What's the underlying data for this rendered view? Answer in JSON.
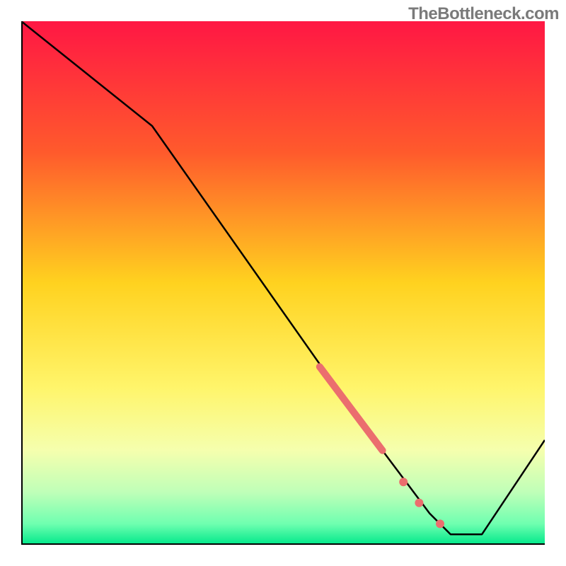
{
  "watermark": "TheBottleneck.com",
  "chart_data": {
    "type": "line",
    "title": "",
    "xlabel": "",
    "ylabel": "",
    "xlim": [
      0,
      100
    ],
    "ylim": [
      0,
      100
    ],
    "grid": false,
    "legend": false,
    "background_gradient": {
      "stops": [
        {
          "offset": 0.0,
          "color": "#ff1744"
        },
        {
          "offset": 0.25,
          "color": "#ff5a2c"
        },
        {
          "offset": 0.5,
          "color": "#ffd21f"
        },
        {
          "offset": 0.7,
          "color": "#fff56b"
        },
        {
          "offset": 0.82,
          "color": "#f5ffae"
        },
        {
          "offset": 0.9,
          "color": "#bfffb8"
        },
        {
          "offset": 0.96,
          "color": "#6fffb0"
        },
        {
          "offset": 1.0,
          "color": "#00e88a"
        }
      ]
    },
    "series": [
      {
        "name": "bottleneck-curve",
        "color": "#000000",
        "x": [
          0,
          25,
          63,
          72,
          78,
          82,
          88,
          100
        ],
        "y": [
          100,
          80,
          26,
          14,
          6,
          2,
          2,
          20
        ]
      }
    ],
    "markers": [
      {
        "name": "highlight-band",
        "type": "thick-segment",
        "color": "#eb6e6e",
        "width": 10,
        "x": [
          57,
          69
        ],
        "y": [
          34,
          18
        ]
      },
      {
        "name": "point-a",
        "type": "dot",
        "color": "#eb6e6e",
        "radius": 6,
        "x": 73,
        "y": 12
      },
      {
        "name": "point-b",
        "type": "dot",
        "color": "#eb6e6e",
        "radius": 6,
        "x": 76,
        "y": 8
      },
      {
        "name": "point-c",
        "type": "dot",
        "color": "#eb6e6e",
        "radius": 6,
        "x": 80,
        "y": 4
      }
    ]
  }
}
